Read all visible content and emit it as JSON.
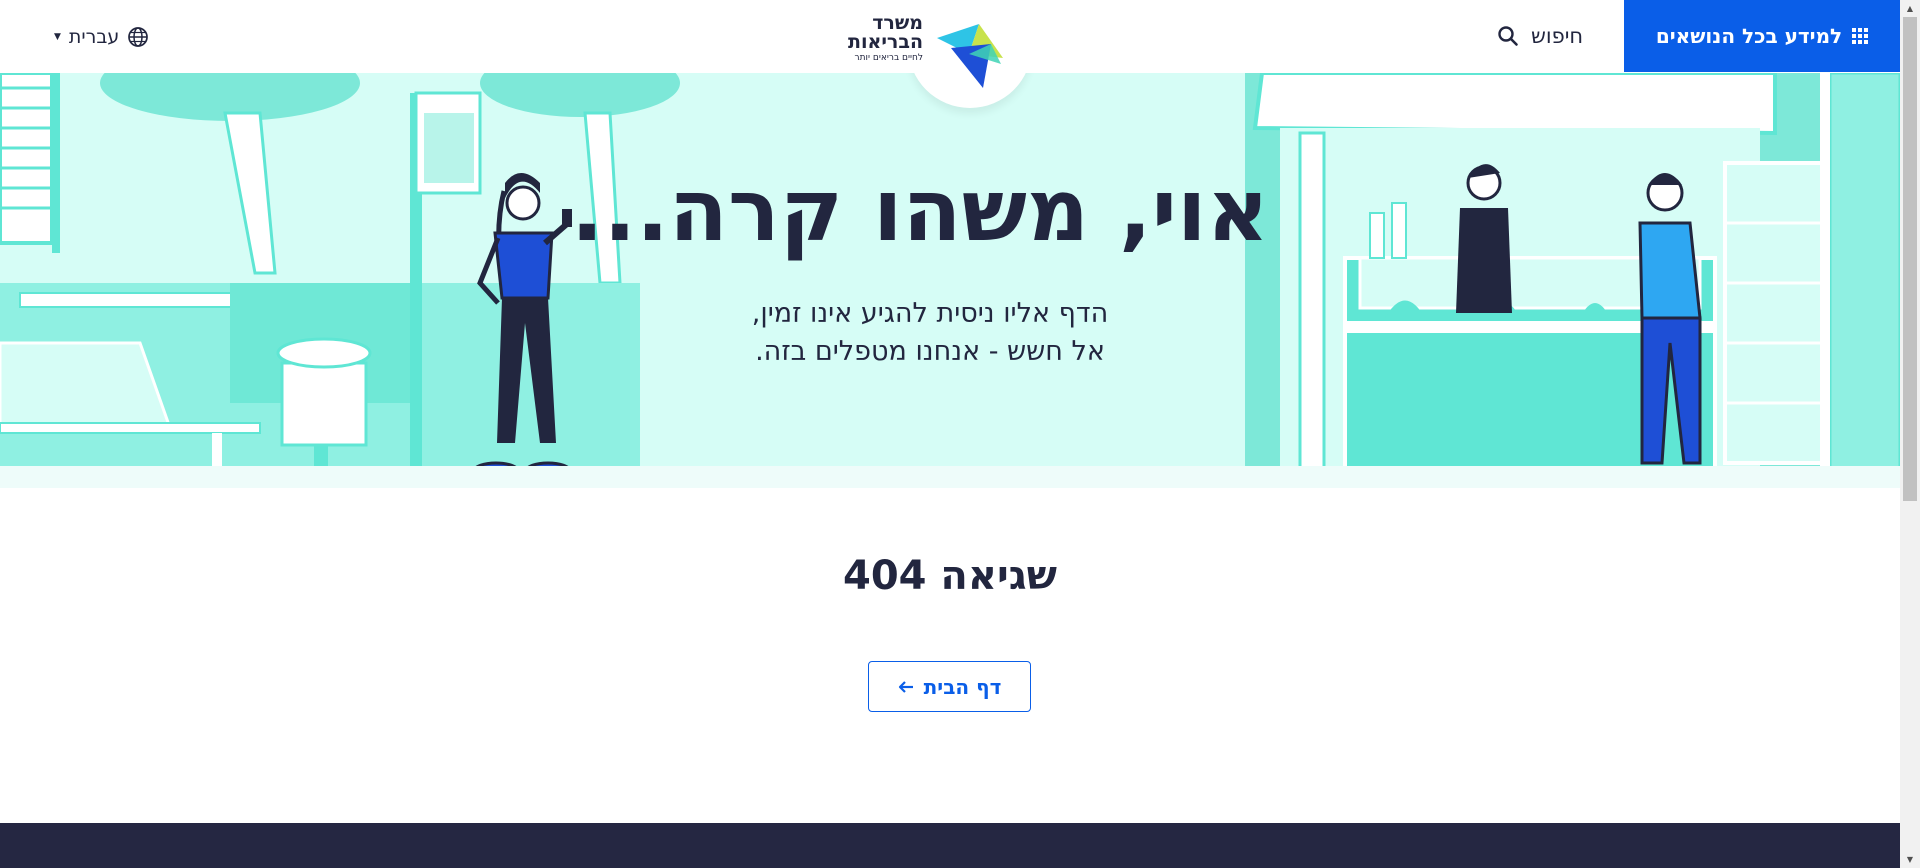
{
  "header": {
    "topics_button": "למידע בכל הנושאים",
    "search_label": "חיפוש",
    "language_label": "עברית",
    "logo": {
      "line1": "משרד",
      "line2": "הבריאות",
      "tagline": "לחיים בריאים יותר"
    }
  },
  "hero": {
    "title": "אוי, משהו קרה...",
    "subtitle_line1": "הדף אליו ניסית להגיע אינו זמין,",
    "subtitle_line2": "אל חשש - אנחנו מטפלים בזה."
  },
  "error": {
    "code_text": "שגיאה 404"
  },
  "home_button": {
    "label": "דף הבית"
  },
  "colors": {
    "brand_blue": "#0a5ee8",
    "navy": "#22263f",
    "hero_bg": "#d6fdf6",
    "mint": "#5fe6d4",
    "footer": "#252742"
  },
  "icons": {
    "grid": "grid-icon",
    "search": "search-icon",
    "globe": "globe-icon",
    "arrow": "arrow-left-icon"
  }
}
